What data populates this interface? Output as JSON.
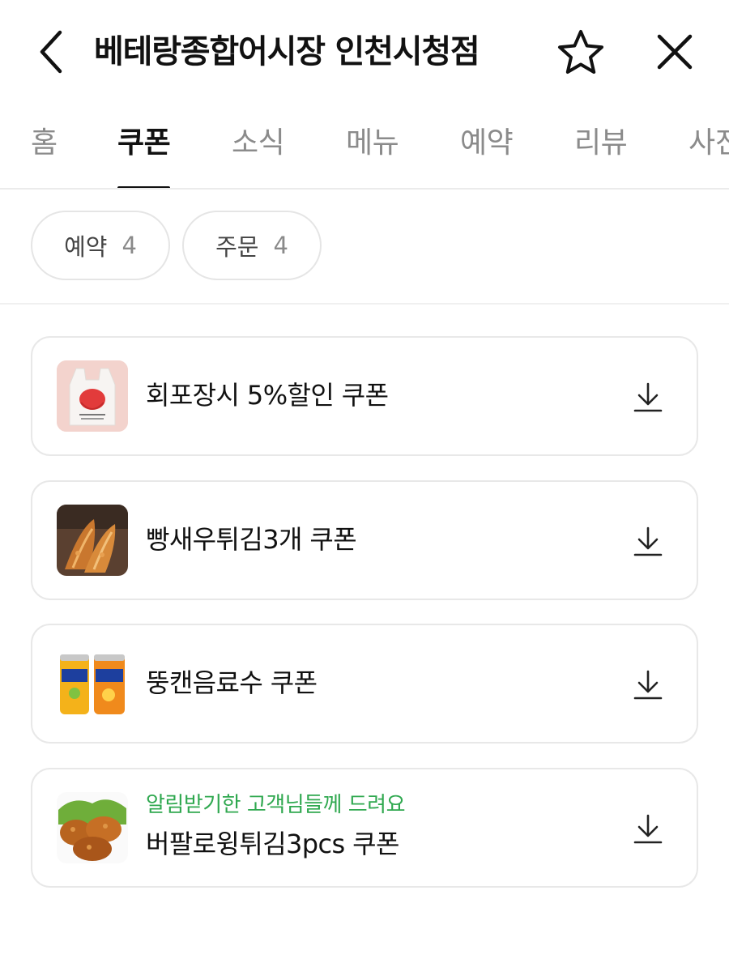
{
  "header": {
    "title": "베테랑종합어시장 인천시청점",
    "back_icon": "chevron-left-icon",
    "favorite_icon": "star-outline-icon",
    "close_icon": "close-icon"
  },
  "tabs": [
    {
      "label": "홈",
      "active": false
    },
    {
      "label": "쿠폰",
      "active": true
    },
    {
      "label": "소식",
      "active": false
    },
    {
      "label": "메뉴",
      "active": false
    },
    {
      "label": "예약",
      "active": false
    },
    {
      "label": "리뷰",
      "active": false
    },
    {
      "label": "사진",
      "active": false
    }
  ],
  "filters": [
    {
      "label": "예약",
      "count": "4"
    },
    {
      "label": "주문",
      "count": "4"
    }
  ],
  "coupons": [
    {
      "title": "회포장시 5%할인 쿠폰",
      "subtitle": "",
      "thumb": "takeout-bag-image",
      "download_icon": "download-icon"
    },
    {
      "title": "빵새우튀김3개 쿠폰",
      "subtitle": "",
      "thumb": "fried-shrimp-image",
      "download_icon": "download-icon"
    },
    {
      "title": "뚱캔음료수 쿠폰",
      "subtitle": "",
      "thumb": "fanta-cans-image",
      "download_icon": "download-icon"
    },
    {
      "title": "버팔로윙튀김3pcs 쿠폰",
      "subtitle": "알림받기한 고객님들께 드려요",
      "thumb": "buffalo-wings-image",
      "download_icon": "download-icon"
    }
  ],
  "colors": {
    "accent_green": "#2fa84f",
    "text_primary": "#111111",
    "text_muted": "#8b8b8b",
    "border": "#e8e8e8"
  }
}
